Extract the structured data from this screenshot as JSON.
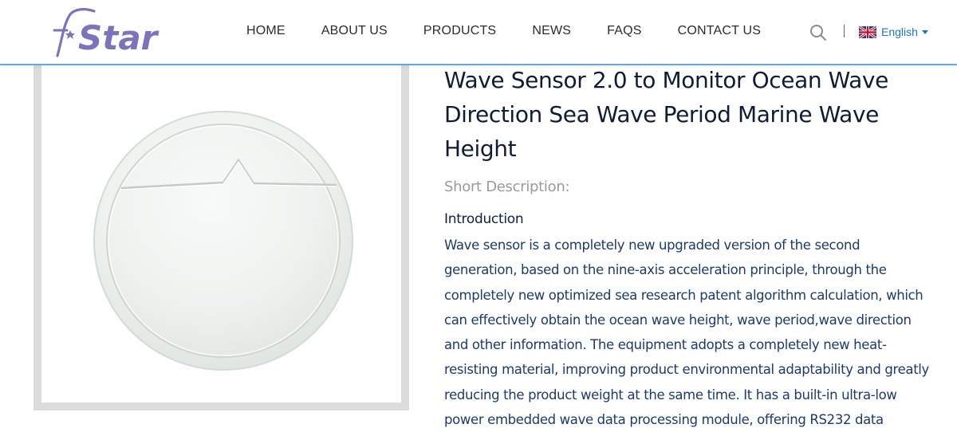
{
  "brand": {
    "logo_text": "Star"
  },
  "nav": {
    "items": [
      "HOME",
      "ABOUT US",
      "PRODUCTS",
      "NEWS",
      "FAQS",
      "CONTACT US"
    ]
  },
  "header": {
    "search_icon": "search-icon",
    "language": {
      "label": "English",
      "flag_icon": "uk-flag-icon"
    }
  },
  "colors": {
    "accent": "#1e73be",
    "logo": "#7b74b8",
    "header_rule": "#6aa6de"
  },
  "product": {
    "title": "Wave Sensor 2.0 to Monitor Ocean Wave Direction Sea Wave Period Marine Wave Height",
    "short_description_label": "Short Description:",
    "intro_heading": "Introduction",
    "intro_text": "Wave sensor is a completely new upgraded version of the second generation, based on the nine-axis acceleration principle, through the completely new optimized sea research patent algorithm calculation, which can effectively obtain the ocean wave height, wave period,wave direction and other information. The equipment adopts a completely new heat-resisting material, improving product environmental adaptability and greatly reducing the product weight at the same time. It has a built-in ultra-low power embedded wave data processing module, offering RS232 data"
  }
}
